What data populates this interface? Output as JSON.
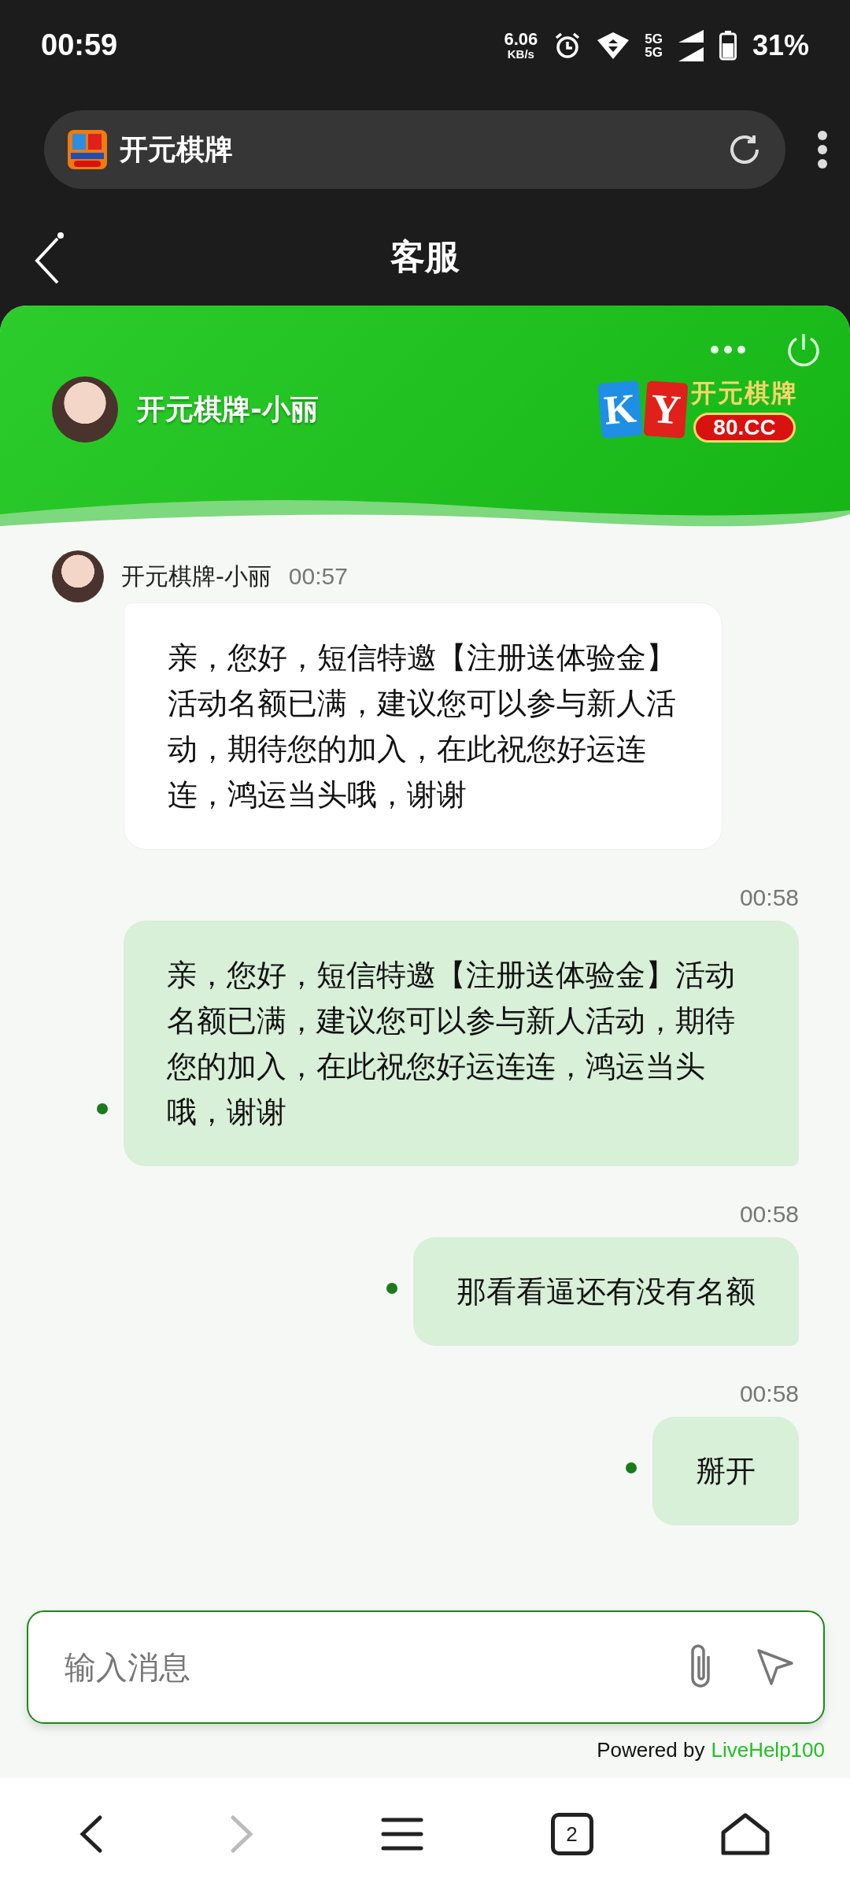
{
  "status_bar": {
    "time": "00:59",
    "net_speed": "6.06",
    "net_unit": "KB/s",
    "network_top": "5G",
    "network_bottom": "5G",
    "battery": "31%"
  },
  "browser": {
    "site_title": "开元棋牌"
  },
  "page": {
    "title": "客服"
  },
  "chat_header": {
    "agent_name": "开元棋牌-小丽",
    "logo_letters": "KY",
    "logo_name": "开元棋牌",
    "logo_domain": "80.CC"
  },
  "messages": [
    {
      "kind": "agent",
      "sender": "开元棋牌-小丽",
      "time": "00:57",
      "text": "亲，您好，短信特邀【注册送体验金】活动名额已满，建议您可以参与新人活动，期待您的加入，在此祝您好运连连，鸿运当头哦，谢谢"
    },
    {
      "kind": "user",
      "time": "00:58",
      "text": "亲，您好，短信特邀【注册送体验金】活动名额已满，建议您可以参与新人活动，期待您的加入，在此祝您好运连连，鸿运当头哦，谢谢"
    },
    {
      "kind": "user",
      "time": "00:58",
      "text": "那看看逼还有没有名额"
    },
    {
      "kind": "user",
      "time": "00:58",
      "text": "掰开"
    }
  ],
  "composer": {
    "placeholder": "输入消息"
  },
  "footer": {
    "powered": "Powered by",
    "brand": "LiveHelp100"
  },
  "bottom_nav": {
    "tab_count": "2"
  }
}
